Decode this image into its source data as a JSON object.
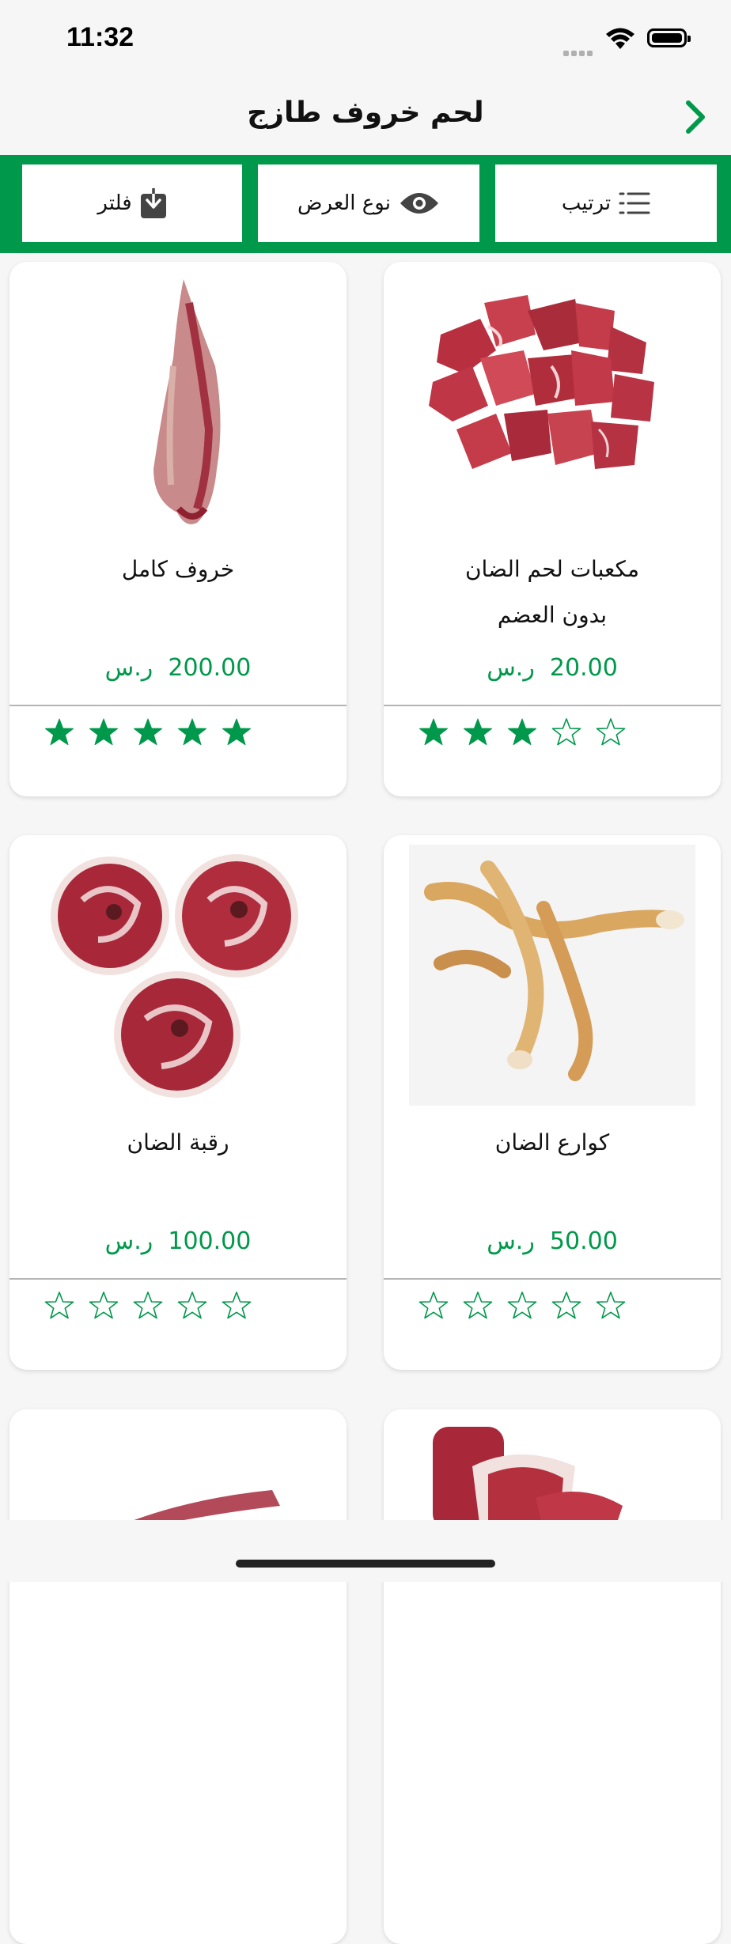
{
  "status_bar": {
    "time": "11:32"
  },
  "nav": {
    "title": "لحم خروف طازج",
    "back_icon": "chevron-right-icon"
  },
  "toolbar": {
    "sort_label": "ترتيب",
    "view_label": "نوع العرض",
    "filter_label": "فلتر"
  },
  "colors": {
    "accent": "#00984a",
    "star_filled": "#00984a"
  },
  "products": [
    {
      "name_line1": "مكعبات لحم الضان",
      "name_line2": "بدون العضم",
      "price": "20.00",
      "currency": "ر.س",
      "rating": 3
    },
    {
      "name_line1": "خروف كامل",
      "name_line2": "",
      "price": "200.00",
      "currency": "ر.س",
      "rating": 5
    },
    {
      "name_line1": "كوارع الضان",
      "name_line2": "",
      "price": "50.00",
      "currency": "ر.س",
      "rating": 0
    },
    {
      "name_line1": "رقبة الضان",
      "name_line2": "",
      "price": "100.00",
      "currency": "ر.س",
      "rating": 0
    }
  ]
}
